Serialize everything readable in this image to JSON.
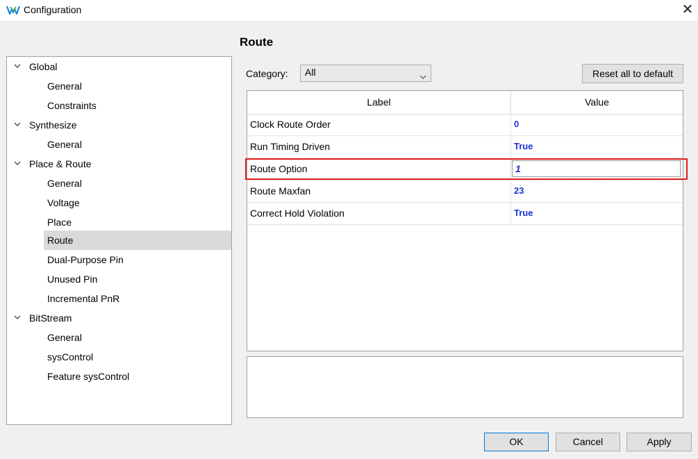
{
  "window": {
    "title": "Configuration",
    "close_glyph": "✕"
  },
  "tree": {
    "items": [
      {
        "label": "Global",
        "level": 0
      },
      {
        "label": "General",
        "level": 1
      },
      {
        "label": "Constraints",
        "level": 1
      },
      {
        "label": "Synthesize",
        "level": 0
      },
      {
        "label": "General",
        "level": 1
      },
      {
        "label": "Place & Route",
        "level": 0
      },
      {
        "label": "General",
        "level": 1
      },
      {
        "label": "Voltage",
        "level": 1
      },
      {
        "label": "Place",
        "level": 1
      },
      {
        "label": "Route",
        "level": 1,
        "selected": true
      },
      {
        "label": "Dual-Purpose Pin",
        "level": 1
      },
      {
        "label": "Unused Pin",
        "level": 1
      },
      {
        "label": "Incremental PnR",
        "level": 1
      },
      {
        "label": "BitStream",
        "level": 0
      },
      {
        "label": "General",
        "level": 1
      },
      {
        "label": "sysControl",
        "level": 1
      },
      {
        "label": "Feature sysControl",
        "level": 1
      }
    ]
  },
  "main": {
    "title": "Route",
    "category_label": "Category:",
    "category_value": "All",
    "reset_label": "Reset all to default",
    "table": {
      "headers": {
        "label": "Label",
        "value": "Value"
      },
      "rows": [
        {
          "label": "Clock Route Order",
          "value": "0"
        },
        {
          "label": "Run Timing Driven",
          "value": "True"
        },
        {
          "label": "Route Option",
          "value": "1",
          "editing": true
        },
        {
          "label": "Route Maxfan",
          "value": "23"
        },
        {
          "label": "Correct Hold Violation",
          "value": "True"
        }
      ]
    }
  },
  "buttons": {
    "ok": "OK",
    "cancel": "Cancel",
    "apply": "Apply"
  },
  "colors": {
    "value_text": "#1a33d6",
    "highlight": "#e02020",
    "selection": "#dadada"
  }
}
